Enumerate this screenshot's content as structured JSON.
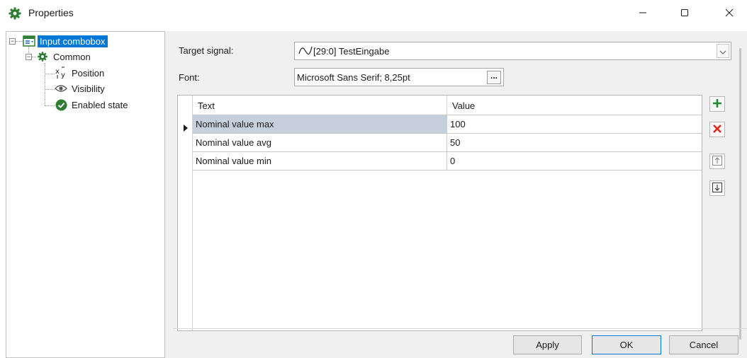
{
  "window": {
    "title": "Properties",
    "icon": "gear-icon",
    "controls": {
      "minimize": "minimize-icon",
      "maximize": "maximize-icon",
      "close": "close-icon"
    }
  },
  "tree": {
    "root": {
      "label": "Input combobox",
      "icon": "combobox-icon",
      "selected": true
    },
    "group": {
      "label": "Common",
      "icon": "gear-icon"
    },
    "children": [
      {
        "label": "Position",
        "icon": "xy-icon"
      },
      {
        "label": "Visibility",
        "icon": "eye-icon"
      },
      {
        "label": "Enabled state",
        "icon": "check-circle-icon"
      }
    ]
  },
  "form": {
    "target_signal_label": "Target signal:",
    "target_signal_value": "[29:0] TestEingabe",
    "font_label": "Font:",
    "font_value": "Microsoft Sans Serif; 8,25pt",
    "font_button": "..."
  },
  "table": {
    "columns": [
      "Text",
      "Value"
    ],
    "rows": [
      {
        "text": "Nominal value max",
        "value": "100",
        "selected": true
      },
      {
        "text": "Nominal value avg",
        "value": "50"
      },
      {
        "text": "Nominal value min",
        "value": "0"
      }
    ]
  },
  "side_buttons": [
    "add-icon",
    "delete-icon",
    "move-up-icon",
    "move-down-icon"
  ],
  "buttons": {
    "apply": "Apply",
    "ok": "OK",
    "cancel": "Cancel"
  },
  "colors": {
    "selection": "#0078d7",
    "row_selected": "#c6d0dd",
    "add": "#1e8c2e",
    "delete": "#e0281e",
    "gear": "#2e7d32"
  }
}
